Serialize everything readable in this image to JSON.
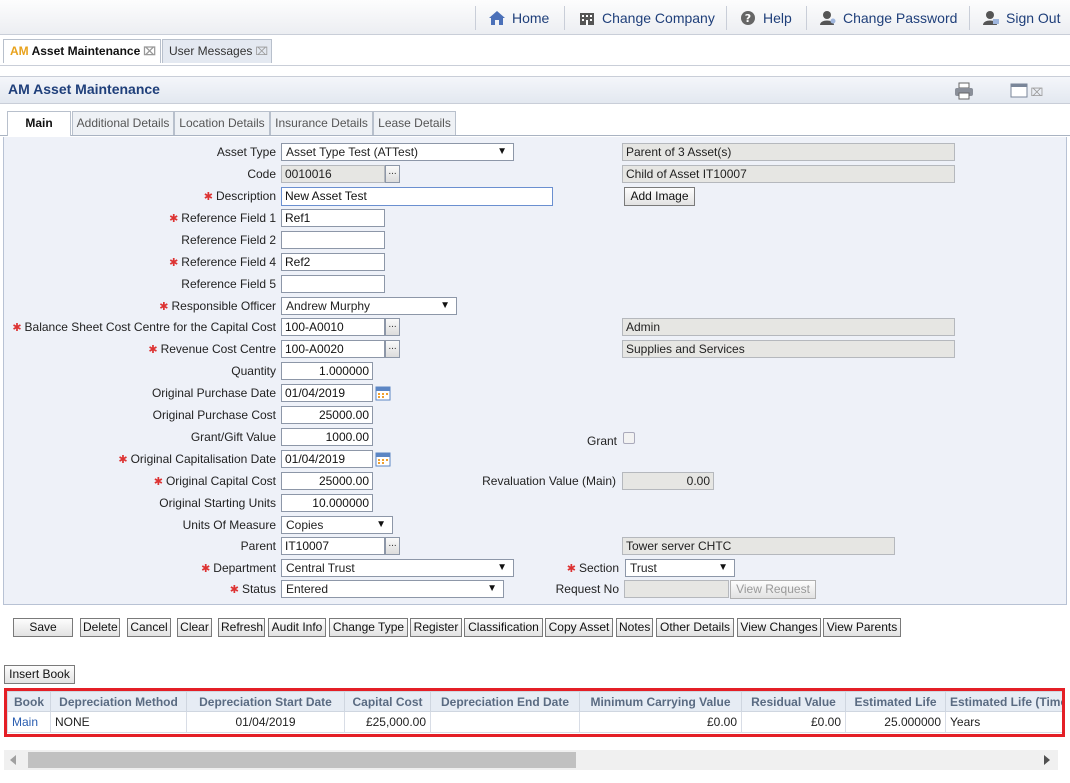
{
  "topnav": {
    "home": "Home",
    "change_company": "Change Company",
    "help": "Help",
    "change_password": "Change Password",
    "sign_out": "Sign Out"
  },
  "window_tabs": [
    {
      "prefix": "AM",
      "label": "Asset Maintenance"
    },
    {
      "label": "User Messages"
    }
  ],
  "page_title": "AM Asset Maintenance",
  "sub_tabs": [
    "Main",
    "Additional Details",
    "Location Details",
    "Insurance Details",
    "Lease Details"
  ],
  "form": {
    "asset_type": {
      "label": "Asset Type",
      "value": "Asset Type Test (ATTest)"
    },
    "code": {
      "label": "Code",
      "value": "0010016"
    },
    "description": {
      "label": "Description",
      "value": "New Asset Test"
    },
    "ref1": {
      "label": "Reference Field 1",
      "value": "Ref1"
    },
    "ref2": {
      "label": "Reference Field 2",
      "value": ""
    },
    "ref4": {
      "label": "Reference Field 4",
      "value": "Ref2"
    },
    "ref5": {
      "label": "Reference Field 5",
      "value": ""
    },
    "responsible_officer": {
      "label": "Responsible Officer",
      "value": "Andrew Murphy"
    },
    "bs_cost_centre": {
      "label": "Balance Sheet Cost Centre for the Capital Cost",
      "value": "100-A0010",
      "desc": "Admin"
    },
    "rev_cost_centre": {
      "label": "Revenue Cost Centre",
      "value": "100-A0020",
      "desc": "Supplies and Services"
    },
    "quantity": {
      "label": "Quantity",
      "value": "1.000000"
    },
    "orig_purchase_date": {
      "label": "Original Purchase Date",
      "value": "01/04/2019"
    },
    "orig_purchase_cost": {
      "label": "Original Purchase Cost",
      "value": "25000.00"
    },
    "grant_gift": {
      "label": "Grant/Gift Value",
      "value": "1000.00"
    },
    "grant": {
      "label": "Grant"
    },
    "orig_cap_date": {
      "label": "Original Capitalisation Date",
      "value": "01/04/2019"
    },
    "orig_cap_cost": {
      "label": "Original Capital Cost",
      "value": "25000.00"
    },
    "revaluation": {
      "label": "Revaluation Value (Main)",
      "value": "0.00"
    },
    "orig_start_units": {
      "label": "Original Starting Units",
      "value": "10.000000"
    },
    "uom": {
      "label": "Units Of Measure",
      "value": "Copies"
    },
    "parent": {
      "label": "Parent",
      "value": "IT10007",
      "desc": "Tower server CHTC"
    },
    "department": {
      "label": "Department",
      "value": "Central Trust"
    },
    "section": {
      "label": "Section",
      "value": "Trust"
    },
    "status": {
      "label": "Status",
      "value": "Entered"
    },
    "request_no": {
      "label": "Request No",
      "value": ""
    },
    "parent_of": "Parent of 3 Asset(s)",
    "child_of": "Child of Asset IT10007",
    "add_image": "Add Image",
    "view_request": "View Request",
    "ellipsis": "..."
  },
  "actions": [
    "Save",
    "Delete",
    "Cancel",
    "Clear",
    "Refresh",
    "Audit Info",
    "Change Type",
    "Register",
    "Classification",
    "Copy Asset",
    "Notes",
    "Other Details",
    "View Changes",
    "View Parents"
  ],
  "insert_book": "Insert Book",
  "book_table": {
    "headers": [
      "Book",
      "Depreciation Method",
      "Depreciation Start Date",
      "Capital Cost",
      "Depreciation End Date",
      "Minimum Carrying Value",
      "Residual Value",
      "Estimated Life",
      "Estimated Life (Time"
    ],
    "rows": [
      [
        "Main",
        "NONE",
        "01/04/2019",
        "£25,000.00",
        "",
        "£0.00",
        "£0.00",
        "25.000000",
        "Years"
      ]
    ]
  },
  "colors": {
    "accent": "#1f3f7a",
    "required": "#dd3333",
    "highlight_border": "#e41f26",
    "am_prefix": "#e8a21c"
  }
}
